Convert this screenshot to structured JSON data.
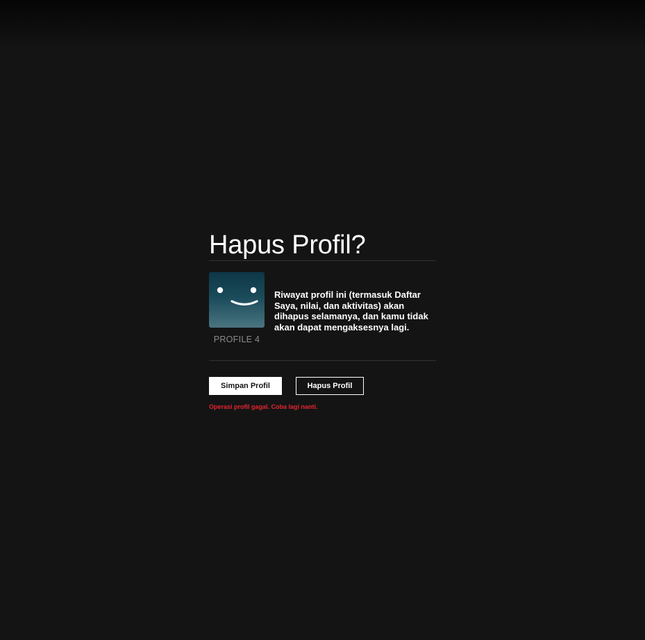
{
  "dialog": {
    "title": "Hapus Profil?",
    "profile_name": "PROFILE 4",
    "message": "Riwayat profil ini (termasuk Daftar Saya, nilai, dan aktivitas) akan dihapus selamanya, dan kamu tidak akan dapat mengaksesnya lagi.",
    "avatar_icon": "smiley-face-icon",
    "avatar_colors": [
      "#0e3746",
      "#4a7480"
    ]
  },
  "actions": {
    "save_label": "Simpan Profil",
    "delete_label": "Hapus Profil"
  },
  "error": {
    "text": "Operasi profil gagal. Coba lagi nanti.",
    "color": "#e5232f"
  },
  "theme": {
    "background": "#141414",
    "divider": "#333333"
  }
}
